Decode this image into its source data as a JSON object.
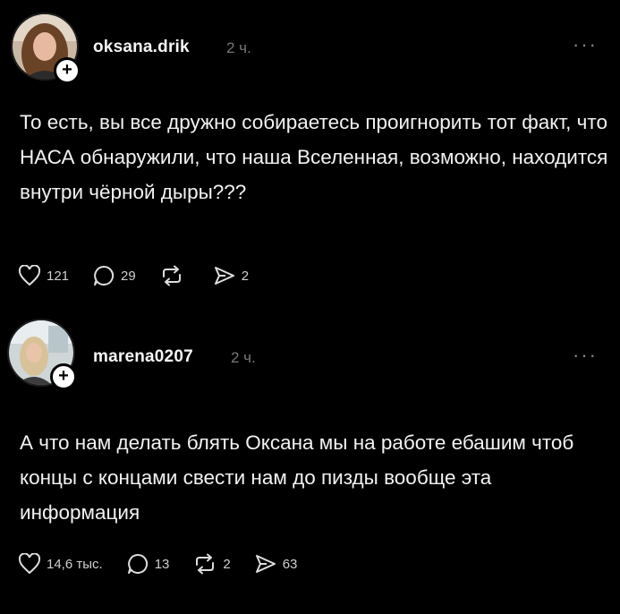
{
  "posts": [
    {
      "username": "oksana.drik",
      "time": "2 ч.",
      "text": "То есть, вы все дружно собираетесь проигнорить тот факт, что НАСА обнаружили, что наша Вселенная, возможно, находится внутри чёрной дыры???",
      "likes": "121",
      "comments": "29",
      "reposts": "",
      "shares": "2"
    },
    {
      "username": "marena0207",
      "time": "2 ч.",
      "text": "А что нам делать блять Оксана мы на работе ебашим чтоб концы с концами свести нам до пизды вообще эта информация",
      "likes": "14,6 тыс.",
      "comments": "13",
      "reposts": "2",
      "shares": "63"
    }
  ],
  "colors": {
    "background": "#000000",
    "text": "#f2f2f2",
    "muted": "#777777"
  },
  "icons": [
    "heart-icon",
    "comment-icon",
    "repost-icon",
    "send-icon",
    "more-icon",
    "plus-icon"
  ]
}
